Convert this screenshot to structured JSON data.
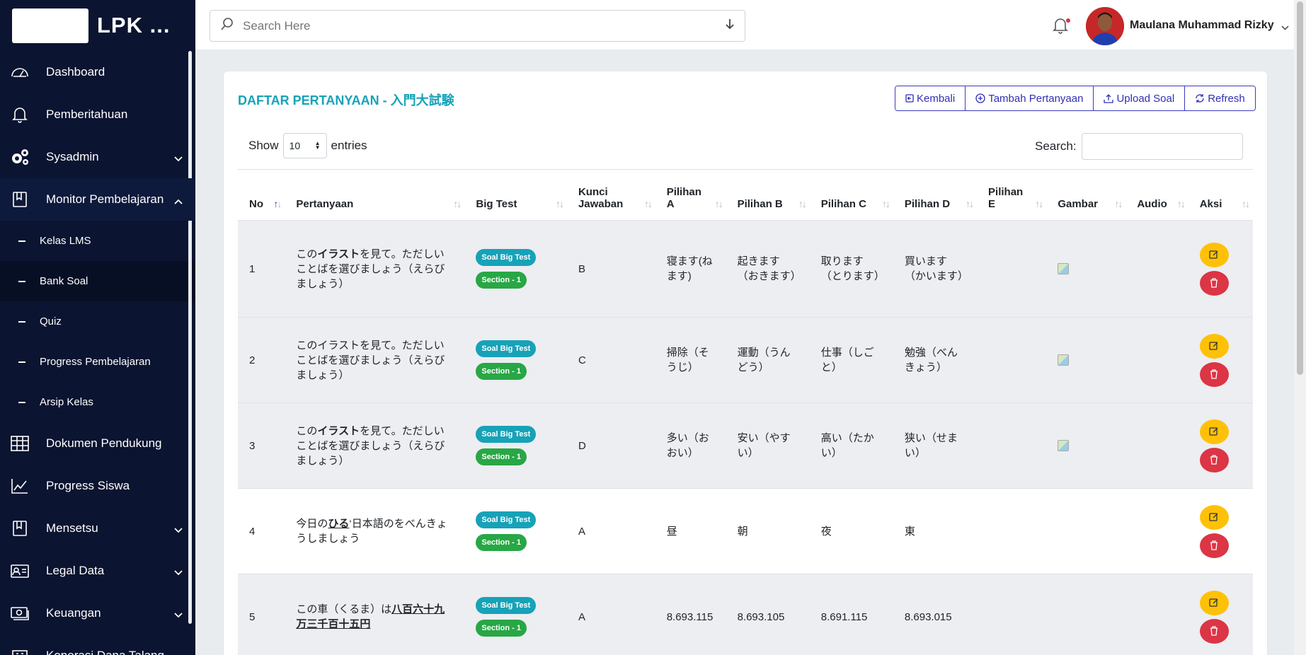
{
  "sidebar": {
    "brand": "LPK ...",
    "items": [
      {
        "label": "Dashboard"
      },
      {
        "label": "Pemberitahuan"
      },
      {
        "label": "Sysadmin"
      },
      {
        "label": "Monitor Pembelajaran"
      }
    ],
    "sub_items": [
      {
        "label": "Kelas LMS"
      },
      {
        "label": "Bank Soal"
      },
      {
        "label": "Quiz"
      },
      {
        "label": "Progress Pembelajaran"
      },
      {
        "label": "Arsip Kelas"
      }
    ],
    "items_after": [
      {
        "label": "Dokumen Pendukung"
      },
      {
        "label": "Progress Siswa"
      },
      {
        "label": "Mensetsu"
      },
      {
        "label": "Legal Data"
      },
      {
        "label": "Keuangan"
      },
      {
        "label": "Koperasi Dana Talang"
      }
    ]
  },
  "topbar": {
    "search_placeholder": "Search Here",
    "user_name": "Maulana Muhammad Rizky"
  },
  "card": {
    "title": "DAFTAR PERTANYAAN - 入門大試験",
    "buttons": {
      "kembali": "Kembali",
      "tambah": "Tambah Pertanyaan",
      "upload": "Upload Soal",
      "refresh": "Refresh"
    },
    "show_label": "Show",
    "entries_value": "10",
    "entries_label": "entries",
    "search_label": "Search:"
  },
  "table": {
    "headers": {
      "no": "No",
      "pertanyaan": "Pertanyaan",
      "big_test": "Big Test",
      "kunci_1": "Kunci",
      "kunci_2": "Jawaban",
      "pa_1": "Pilihan",
      "pa_2": "A",
      "pb": "Pilihan B",
      "pc": "Pilihan C",
      "pd": "Pilihan D",
      "pe_1": "Pilihan",
      "pe_2": "E",
      "gambar": "Gambar",
      "audio": "Audio",
      "aksi": "Aksi"
    },
    "badge_test": "Soal Big Test",
    "badge_section": "Section - 1",
    "rows": [
      {
        "no": "1",
        "q1": "この",
        "q2": "イラスト",
        "q3": "を見て。ただしいことばを選びましょう（えらびましょう）",
        "key": "B",
        "a": "寝ます(ねます)",
        "b": "起きます（おきます）",
        "c": "取ります（とります）",
        "d": "買います（かいます）"
      },
      {
        "no": "2",
        "q1": "",
        "q2": "",
        "q3": "このイラストを見て。ただしいことばを選びましょう（えらびましょう）",
        "key": "C",
        "a": "掃除（そうじ）",
        "b": "運動（うんどう）",
        "c": "仕事（しごと）",
        "d": "勉強（べんきょう）"
      },
      {
        "no": "3",
        "q1": "この",
        "q2": "イラスト",
        "q3": "を見て。ただしいことばを選びましょう（えらびましょう）",
        "key": "D",
        "a": "多い（おおい）",
        "b": "安い（やすい）",
        "c": "高い（たかい）",
        "d": "狭い（せまい）"
      },
      {
        "no": "4",
        "q1": "今日の",
        "q2": "ひる",
        "q3": "‘日本語のをべんきょうしましょう",
        "key": "A",
        "a": "昼",
        "b": "朝",
        "c": "夜",
        "d": "東"
      },
      {
        "no": "5",
        "q1": "この車（くるま）は",
        "q2": "八百六十九万三千百十五円",
        "q3": "",
        "key": "A",
        "a": "8.693.115",
        "b": "8.693.105",
        "c": "8.691.115",
        "d": "8.693.015"
      }
    ]
  }
}
